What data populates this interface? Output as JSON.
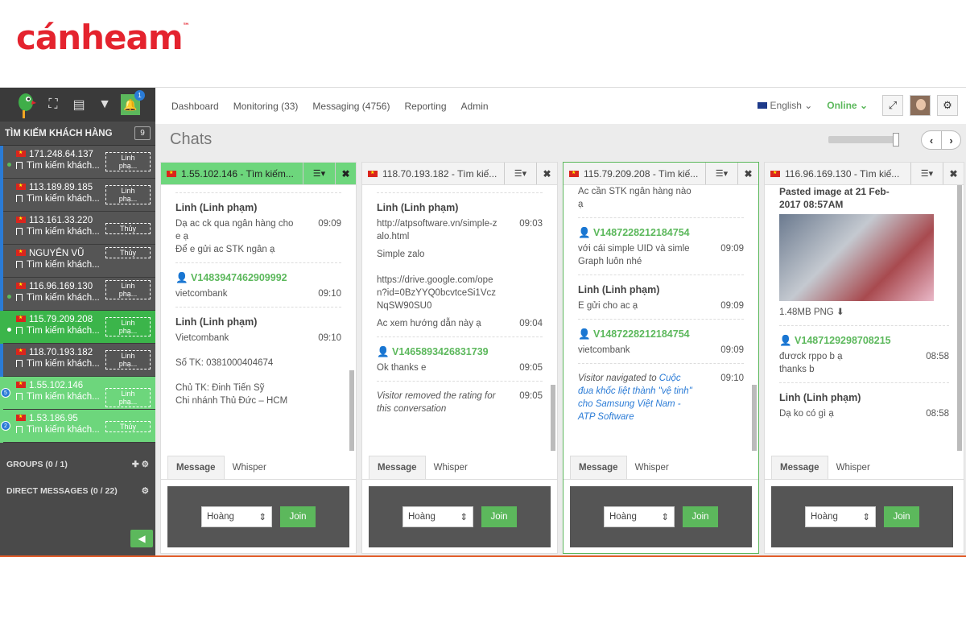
{
  "brand": {
    "logo": "cánheam",
    "tm": "™"
  },
  "sidebar": {
    "notif_count": "1",
    "search_title": "TÌM KIẾM KHÁCH HÀNG",
    "search_count": "9",
    "visitors": [
      {
        "ip": "171.248.64.137",
        "sub": "Tìm kiếm khách...",
        "tag": "Linh phạ..."
      },
      {
        "ip": "113.189.89.185",
        "sub": "Tìm kiếm khách...",
        "tag": "Linh phạ..."
      },
      {
        "ip": "113.161.33.220",
        "sub": "Tìm kiếm khách...",
        "tag": "Thủy"
      },
      {
        "ip": "NGUYÊN VŨ",
        "sub": "Tìm kiếm khách...",
        "tag": "Thủy"
      },
      {
        "ip": "116.96.169.130",
        "sub": "Tìm kiếm khách...",
        "tag": "Linh phạ..."
      },
      {
        "ip": "115.79.209.208",
        "sub": "Tìm kiếm khách...",
        "tag": "Linh phạ..."
      },
      {
        "ip": "118.70.193.182",
        "sub": "Tìm kiếm khách...",
        "tag": "Linh phạ..."
      },
      {
        "ip": "1.55.102.146",
        "sub": "Tìm kiếm khách...",
        "tag": "Linh phạ...",
        "badge": "5"
      },
      {
        "ip": "1.53.186.95",
        "sub": "Tìm kiếm khách...",
        "tag": "Thủy",
        "badge": "2"
      }
    ],
    "groups": "GROUPS (0 / 1)",
    "direct": "DIRECT MESSAGES (0 / 22)"
  },
  "nav": {
    "items": [
      "Dashboard",
      "Monitoring (33)",
      "Messaging (4756)",
      "Reporting",
      "Admin"
    ],
    "language": "English",
    "status": "Online"
  },
  "chats_title": "Chats",
  "panels": [
    {
      "title": "1.55.102.146 - Tìm kiếm...",
      "m1_who": "Linh (Linh phạm)",
      "m1_t1": "Dạ ac ck qua ngân hàng cho e ạ",
      "m1_time": "09:09",
      "m1_t2": "Để e gửi ac STK ngân ạ",
      "m2_who": "V1483947462909992",
      "m2_t": "vietcombank",
      "m2_time": "09:10",
      "m3_who": "Linh (Linh phạm)",
      "m3_t": "Vietcombank",
      "m3_time": "09:10",
      "m3_a": "Số TK: 0381000404674",
      "m3_b": "Chủ TK: Đinh Tiến Sỹ",
      "m3_c": "Chi nhánh Thủ Đức – HCM"
    },
    {
      "title": "118.70.193.182 - Tìm kiế...",
      "m1_who": "Linh (Linh phạm)",
      "m1_link": "http://atpsoftware.vn/simple-zalo.html",
      "m1_time": "09:03",
      "m1_t": "Simple zalo",
      "m1_link2": "https://drive.google.com/open?id=0BzYYQ0bcvtceSi1VczNqSW90SU0",
      "m1_t2": "Ac xem hướng dẫn này ạ",
      "m1_time2": "09:04",
      "m2_who": "V1465893426831739",
      "m2_t": "Ok thanks e",
      "m2_time": "09:05",
      "m3_t": "Visitor removed the rating for this conversation",
      "m3_time": "09:05"
    },
    {
      "title": "115.79.209.208 - Tìm kiế...",
      "m0_t": "Ac cần STK ngân hàng nào ạ",
      "m1_who": "V1487228212184754",
      "m1_t": "với cái simple UID và simle Graph luôn nhé",
      "m1_time": "09:09",
      "m2_who": "Linh (Linh phạm)",
      "m2_t": "E gửi cho ac ạ",
      "m2_time": "09:09",
      "m3_who": "V1487228212184754",
      "m3_t": "vietcombank",
      "m3_time": "09:09",
      "m4_pre": "Visitor navigated to ",
      "m4_link": "Cuộc đua khốc liệt thành \"vệ tinh\" cho Samsung Việt Nam - ATP Software",
      "m4_time": "09:10"
    },
    {
      "title": "116.96.169.130 - Tìm kiế...",
      "m0_t": "Pasted image at 21 Feb-2017 08:57AM",
      "m0_file": "1.48MB PNG",
      "m1_who": "V1487129298708215",
      "m1_t": "đươck rppo b ạ",
      "m1_time": "08:58",
      "m1_t2": "thanks b",
      "m2_who": "Linh (Linh phạm)",
      "m2_t": "Dạ ko có gì ạ",
      "m2_time": "08:58"
    }
  ],
  "composer": {
    "tab_message": "Message",
    "tab_whisper": "Whisper",
    "agent": "Hoàng",
    "join": "Join"
  }
}
